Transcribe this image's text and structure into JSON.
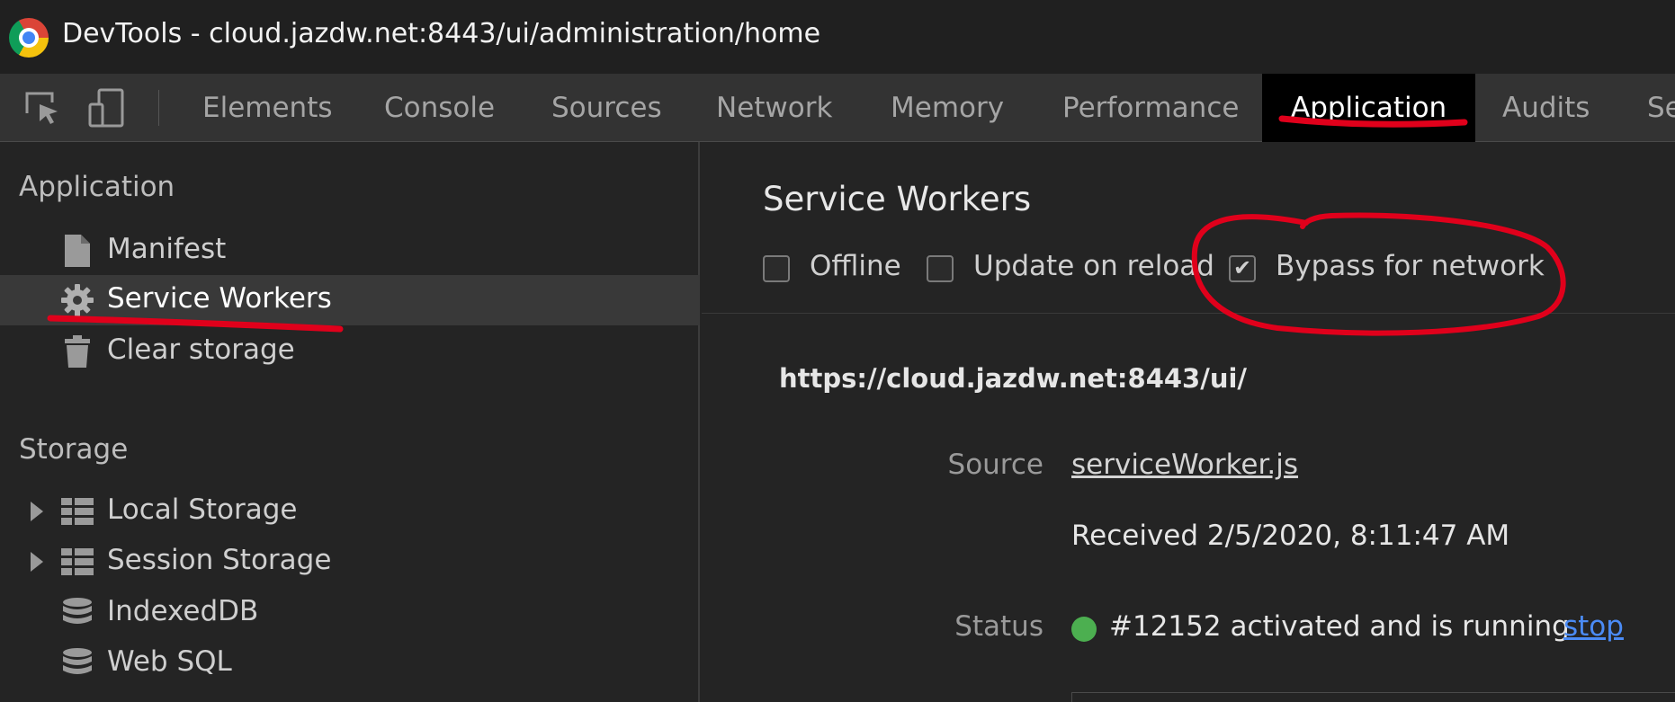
{
  "window": {
    "title": "DevTools - cloud.jazdw.net:8443/ui/administration/home"
  },
  "toolbar": {
    "tabs": [
      {
        "label": "Elements"
      },
      {
        "label": "Console"
      },
      {
        "label": "Sources"
      },
      {
        "label": "Network"
      },
      {
        "label": "Memory"
      },
      {
        "label": "Performance"
      },
      {
        "label": "Application",
        "active": true
      },
      {
        "label": "Audits"
      },
      {
        "label": "Se"
      }
    ]
  },
  "sidebar": {
    "application_title": "Application",
    "application_items": [
      {
        "label": "Manifest",
        "icon": "file-icon"
      },
      {
        "label": "Service Workers",
        "icon": "gear-icon",
        "selected": true
      },
      {
        "label": "Clear storage",
        "icon": "trash-icon"
      }
    ],
    "storage_title": "Storage",
    "storage_items": [
      {
        "label": "Local Storage",
        "icon": "grid-icon",
        "expandable": true
      },
      {
        "label": "Session Storage",
        "icon": "grid-icon",
        "expandable": true
      },
      {
        "label": "IndexedDB",
        "icon": "database-icon"
      },
      {
        "label": "Web SQL",
        "icon": "database-icon"
      }
    ]
  },
  "main": {
    "title": "Service Workers",
    "options": {
      "offline": {
        "label": "Offline",
        "checked": false
      },
      "update_on_reload": {
        "label": "Update on reload",
        "checked": false
      },
      "bypass_for_network": {
        "label": "Bypass for network",
        "checked": true
      }
    },
    "worker": {
      "scope_url": "https://cloud.jazdw.net:8443/ui/",
      "source_label": "Source",
      "source_file": "serviceWorker.js",
      "received": "Received 2/5/2020, 8:11:47 AM",
      "status_label": "Status",
      "status_text": "#12152 activated and is running",
      "status_color": "#4caf50",
      "stop_label": "stop"
    }
  },
  "colors": {
    "accent_link": "#4b8bf5",
    "annotation": "#e0001b"
  }
}
